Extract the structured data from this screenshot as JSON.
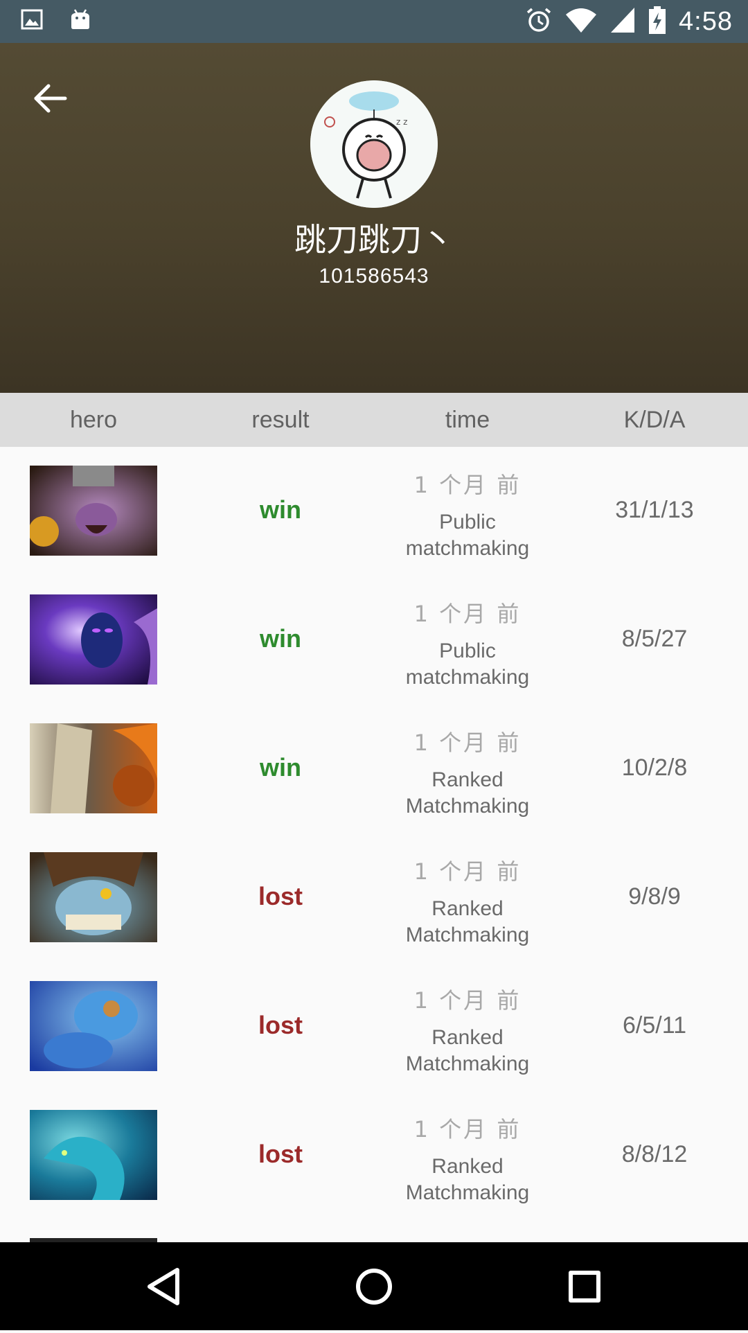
{
  "status_bar": {
    "time": "4:58",
    "left_icons": [
      "image-icon",
      "android-icon"
    ],
    "right_icons": [
      "alarm-icon",
      "wifi-icon",
      "signal-icon",
      "battery-icon"
    ]
  },
  "header": {
    "username": "跳刀跳刀丶",
    "user_id": "101586543",
    "back_icon": "arrow-left-icon"
  },
  "columns": {
    "hero": "hero",
    "result": "result",
    "time": "time",
    "kda": "K/D/A"
  },
  "matches": [
    {
      "hero_icon": "hero-portrait-1",
      "result": "win",
      "time_ago": "1 个月 前",
      "mode_line1": "Public",
      "mode_line2": "matchmaking",
      "kda": "31/1/13"
    },
    {
      "hero_icon": "hero-portrait-2",
      "result": "win",
      "time_ago": "1 个月 前",
      "mode_line1": "Public",
      "mode_line2": "matchmaking",
      "kda": "8/5/27"
    },
    {
      "hero_icon": "hero-portrait-3",
      "result": "win",
      "time_ago": "1 个月 前",
      "mode_line1": "Ranked",
      "mode_line2": "Matchmaking",
      "kda": "10/2/8"
    },
    {
      "hero_icon": "hero-portrait-4",
      "result": "lost",
      "time_ago": "1 个月 前",
      "mode_line1": "Ranked",
      "mode_line2": "Matchmaking",
      "kda": "9/8/9"
    },
    {
      "hero_icon": "hero-portrait-5",
      "result": "lost",
      "time_ago": "1 个月 前",
      "mode_line1": "Ranked",
      "mode_line2": "Matchmaking",
      "kda": "6/5/11"
    },
    {
      "hero_icon": "hero-portrait-6",
      "result": "lost",
      "time_ago": "1 个月 前",
      "mode_line1": "Ranked",
      "mode_line2": "Matchmaking",
      "kda": "8/8/12"
    }
  ],
  "colors": {
    "status_bar": "#455a64",
    "header": "#4a412c",
    "win": "#2e8b2e",
    "lost": "#9b2a2a"
  },
  "nav_bar": {
    "icons": [
      "back-triangle-icon",
      "home-circle-icon",
      "recents-square-icon"
    ]
  }
}
